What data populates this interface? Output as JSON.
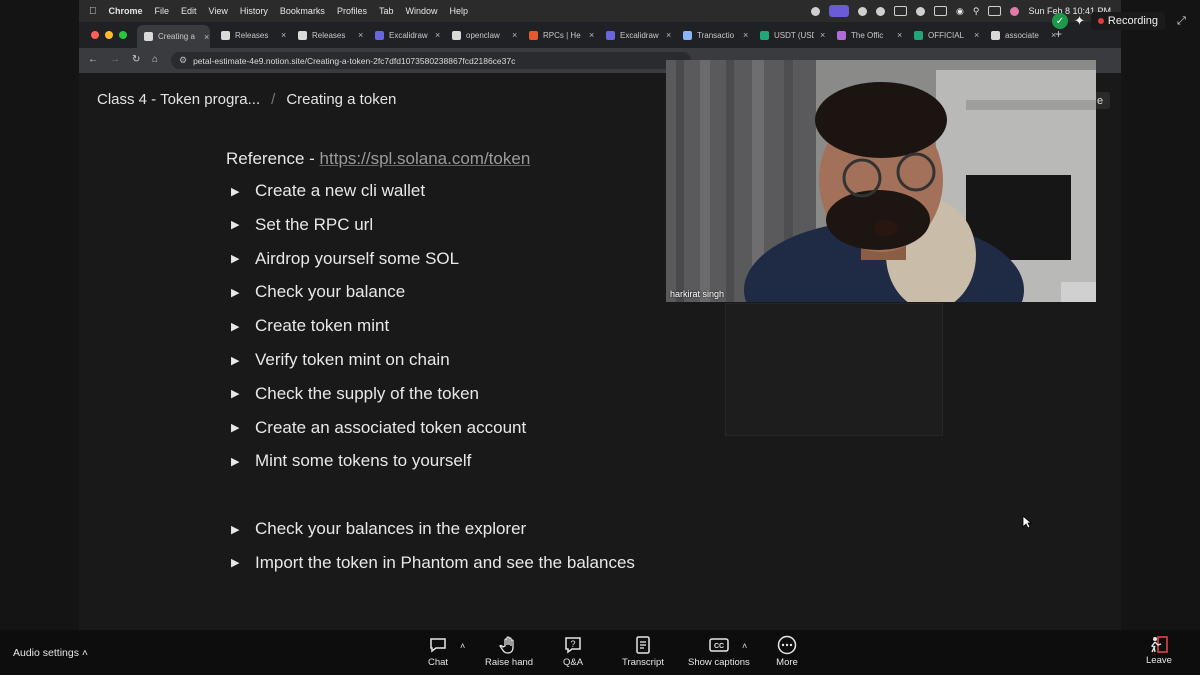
{
  "menubar": {
    "app": "Chrome",
    "items": [
      "File",
      "Edit",
      "View",
      "History",
      "Bookmarks",
      "Profiles",
      "Tab",
      "Window",
      "Help"
    ],
    "clock": "Sun Feb 8  10:41 PM"
  },
  "tabs": [
    {
      "label": "Creating a",
      "color": "#d9d9d9",
      "active": true
    },
    {
      "label": "Releases",
      "color": "#d9d9d9"
    },
    {
      "label": "Releases",
      "color": "#d9d9d9"
    },
    {
      "label": "Excalidraw",
      "color": "#6965db"
    },
    {
      "label": "openclaw",
      "color": "#d9d9d9"
    },
    {
      "label": "RPCs | He",
      "color": "#e8582e"
    },
    {
      "label": "Excalidraw",
      "color": "#6965db"
    },
    {
      "label": "Transactio",
      "color": "#8ab4f8"
    },
    {
      "label": "USDT (USD",
      "color": "#21a67a"
    },
    {
      "label": "The Offic",
      "color": "#b06bd6"
    },
    {
      "label": "OFFICIAL",
      "color": "#21a67a"
    },
    {
      "label": "associate",
      "color": "#d9d9d9"
    }
  ],
  "tab_close": "×",
  "new_tab": "+",
  "address": {
    "url": "petal-estimate-4e9.notion.site/Creating-a-token-2fc7dfd1073580238867fcd2186ce37c"
  },
  "page": {
    "breadcrumb_parent": "Class 4 - Token progra...",
    "breadcrumb_sep": "/",
    "breadcrumb_current": "Creating a token",
    "reference_label": "Reference - ",
    "reference_link": "https://spl.solana.com/token",
    "toggles_group1": [
      "Create a new cli wallet",
      "Set the RPC url",
      "Airdrop yourself some SOL",
      "Check your balance",
      "Create token mint",
      "Verify token mint on chain",
      "Check the supply of the token",
      "Create an associated token account",
      "Mint some tokens to yourself"
    ],
    "toggles_group2": [
      "Check your balances in the explorer",
      "Import the token in Phantom and see the balances"
    ]
  },
  "video": {
    "participant": "harkirat singh"
  },
  "recording": {
    "label": "Recording"
  },
  "meeting_bar": {
    "audio_settings": "Audio settings",
    "chat": "Chat",
    "raise_hand": "Raise hand",
    "qa": "Q&A",
    "transcript": "Transcript",
    "show_captions": "Show captions",
    "more": "More",
    "leave": "Leave"
  }
}
